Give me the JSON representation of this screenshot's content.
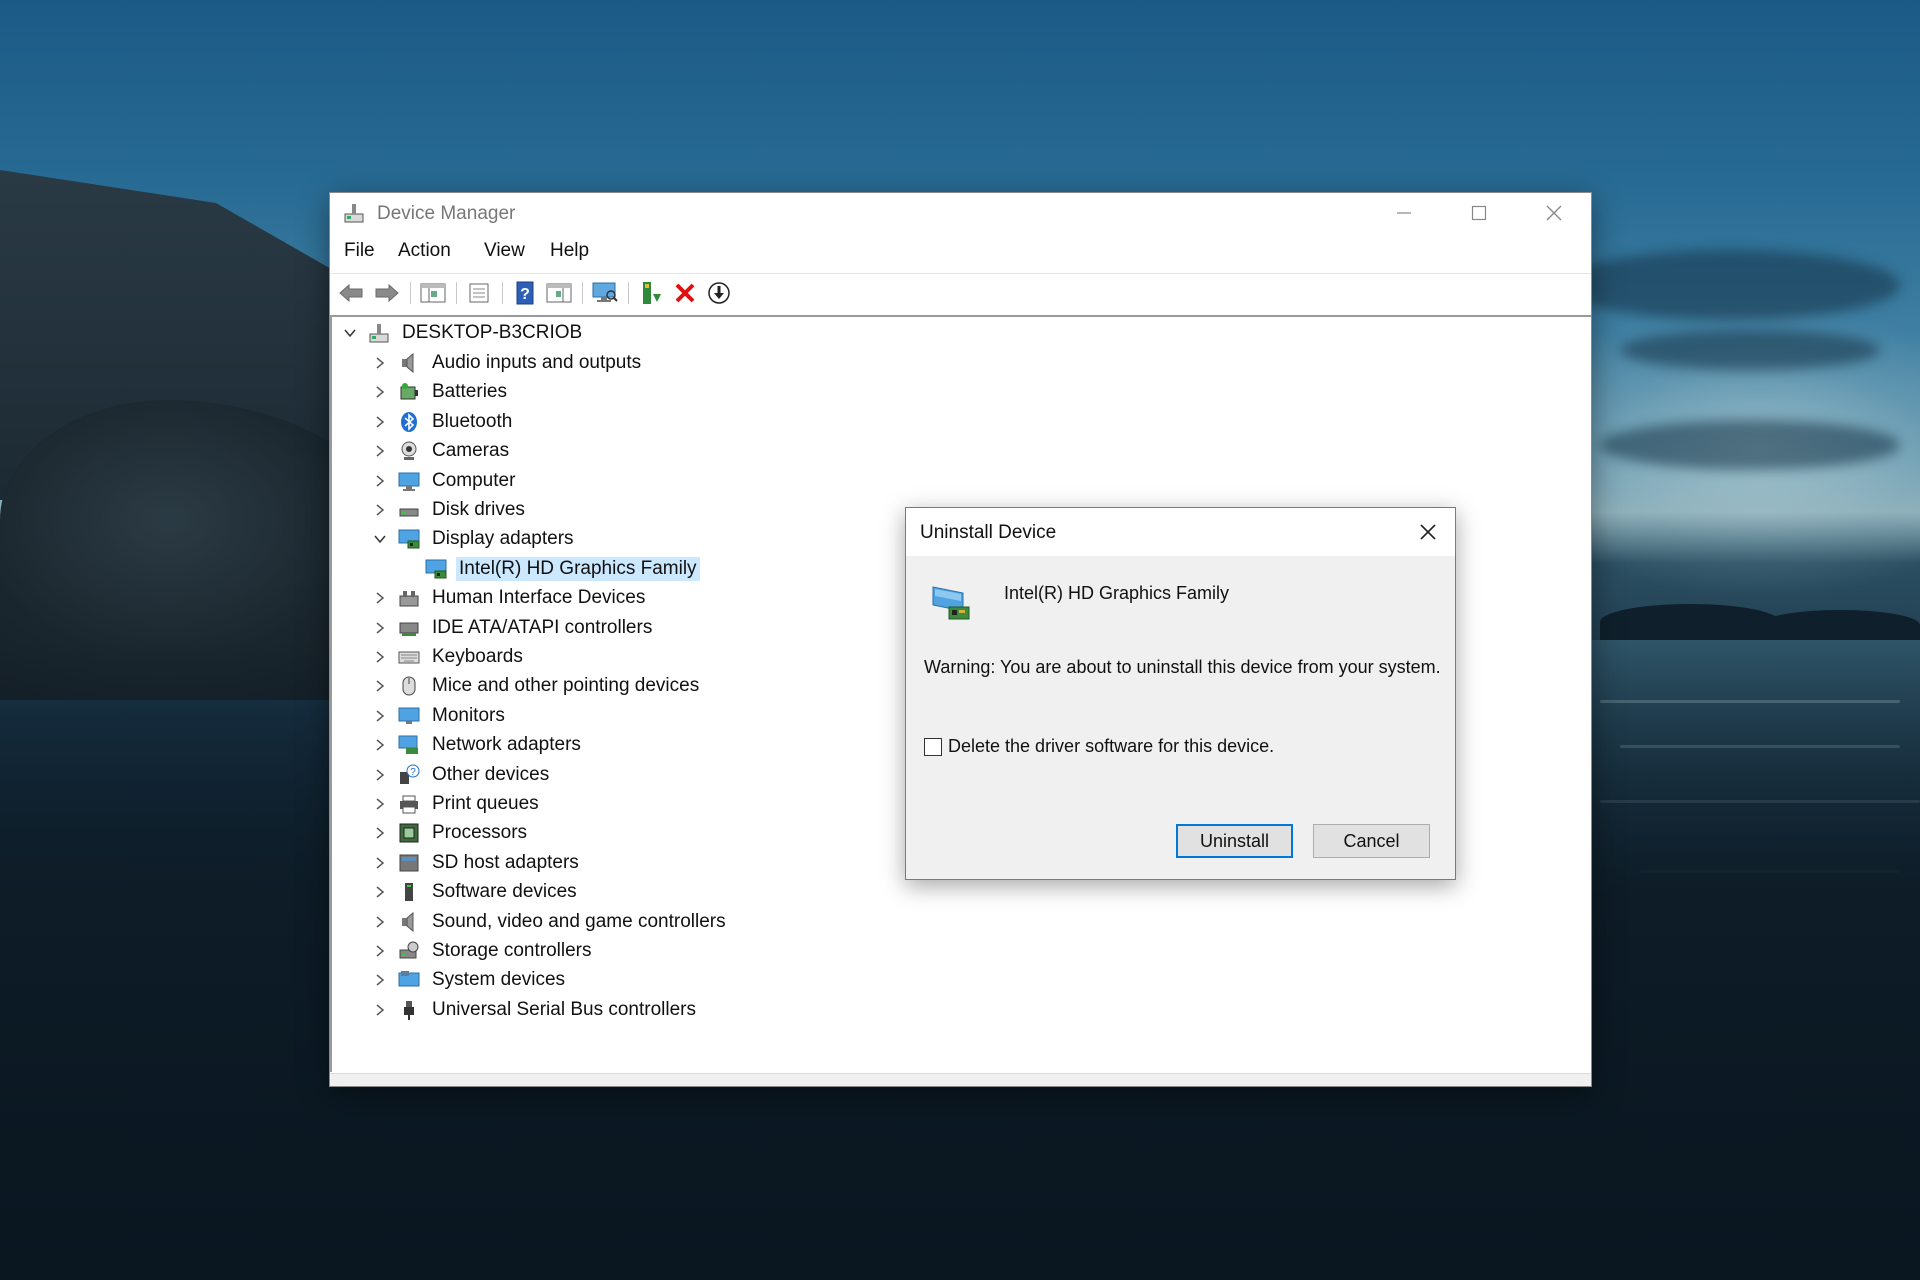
{
  "window": {
    "title": "Device Manager",
    "controls": {
      "minimize": "minimize",
      "maximize": "maximize",
      "close": "close"
    }
  },
  "menu": [
    "File",
    "Action",
    "View",
    "Help"
  ],
  "toolbar": [
    {
      "name": "back-arrow-icon"
    },
    {
      "name": "forward-arrow-icon"
    },
    {
      "name": "show-hide-console-tree-icon"
    },
    {
      "name": "properties-icon"
    },
    {
      "name": "help-icon"
    },
    {
      "name": "action-pane-icon"
    },
    {
      "name": "scan-hardware-icon"
    },
    {
      "name": "update-driver-icon"
    },
    {
      "name": "uninstall-device-icon"
    },
    {
      "name": "disable-device-icon"
    }
  ],
  "tree": {
    "root": "DESKTOP-B3CRIOB",
    "items": [
      {
        "label": "Audio inputs and outputs",
        "icon": "speaker-icon",
        "expanded": false
      },
      {
        "label": "Batteries",
        "icon": "battery-icon",
        "expanded": false
      },
      {
        "label": "Bluetooth",
        "icon": "bluetooth-icon",
        "expanded": false
      },
      {
        "label": "Cameras",
        "icon": "camera-icon",
        "expanded": false
      },
      {
        "label": "Computer",
        "icon": "computer-icon",
        "expanded": false
      },
      {
        "label": "Disk drives",
        "icon": "disk-drive-icon",
        "expanded": false
      },
      {
        "label": "Display adapters",
        "icon": "display-adapter-icon",
        "expanded": true
      },
      {
        "label": "Intel(R) HD Graphics Family",
        "icon": "display-adapter-icon",
        "child": true,
        "selected": true
      },
      {
        "label": "Human Interface Devices",
        "icon": "hid-icon",
        "expanded": false
      },
      {
        "label": "IDE ATA/ATAPI controllers",
        "icon": "ide-controller-icon",
        "expanded": false
      },
      {
        "label": "Keyboards",
        "icon": "keyboard-icon",
        "expanded": false
      },
      {
        "label": "Mice and other pointing devices",
        "icon": "mouse-icon",
        "expanded": false
      },
      {
        "label": "Monitors",
        "icon": "monitor-icon",
        "expanded": false
      },
      {
        "label": "Network adapters",
        "icon": "network-adapter-icon",
        "expanded": false
      },
      {
        "label": "Other devices",
        "icon": "other-devices-icon",
        "expanded": false
      },
      {
        "label": "Print queues",
        "icon": "printer-icon",
        "expanded": false
      },
      {
        "label": "Processors",
        "icon": "processor-icon",
        "expanded": false
      },
      {
        "label": "SD host adapters",
        "icon": "sd-card-icon",
        "expanded": false
      },
      {
        "label": "Software devices",
        "icon": "software-device-icon",
        "expanded": false
      },
      {
        "label": "Sound, video and game controllers",
        "icon": "sound-icon",
        "expanded": false
      },
      {
        "label": "Storage controllers",
        "icon": "storage-controller-icon",
        "expanded": false
      },
      {
        "label": "System devices",
        "icon": "system-devices-icon",
        "expanded": false
      },
      {
        "label": "Universal Serial Bus controllers",
        "icon": "usb-icon",
        "expanded": false
      }
    ]
  },
  "dialog": {
    "title": "Uninstall Device",
    "device_name": "Intel(R) HD Graphics Family",
    "warning": "Warning: You are about to uninstall this device from your system.",
    "checkbox_label": "Delete the driver software for this device.",
    "checkbox_checked": false,
    "uninstall_label": "Uninstall",
    "cancel_label": "Cancel"
  },
  "colors": {
    "selection": "#cce8ff",
    "default_button_border": "#0078d7",
    "dialog_bg": "#f0f0f0"
  }
}
